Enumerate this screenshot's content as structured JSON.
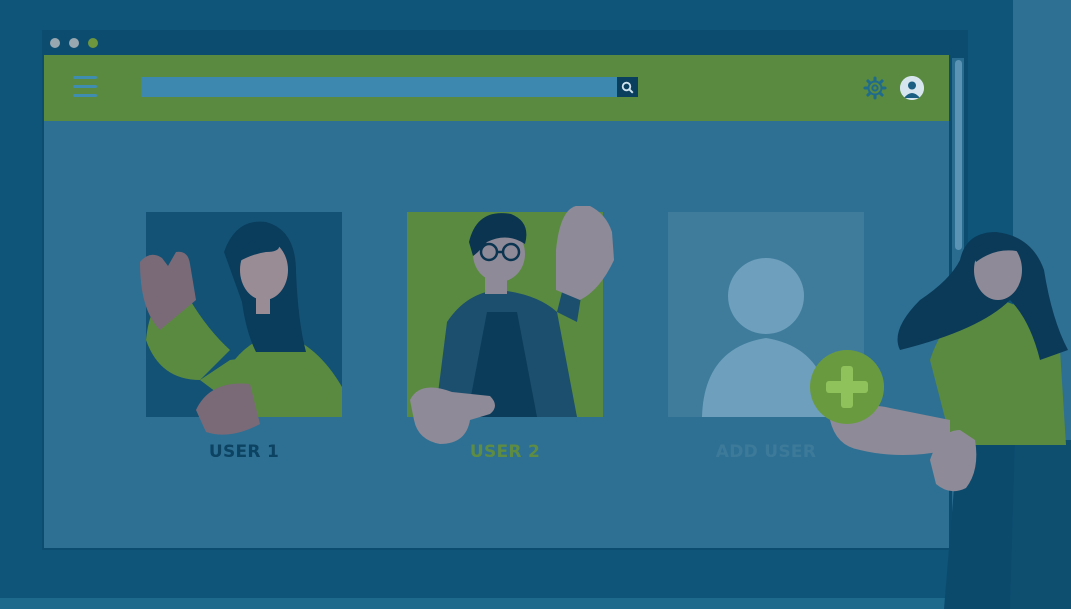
{
  "window": {
    "dots": [
      {
        "name": "close-dot",
        "color": "#98a7b0"
      },
      {
        "name": "minimize-dot",
        "color": "#98a7b0"
      },
      {
        "name": "maximize-dot",
        "color": "#6d963e"
      }
    ]
  },
  "toolbar": {
    "menu_icon": "hamburger-menu-icon",
    "search_placeholder": "",
    "search_icon": "search-icon",
    "settings_icon": "gear-icon",
    "account_icon": "user-avatar-icon"
  },
  "users": [
    {
      "label": "USER 1"
    },
    {
      "label": "USER 2"
    }
  ],
  "add_user": {
    "label": "ADD USER",
    "icon": "plus-icon"
  },
  "colors": {
    "background": "#0e5579",
    "toolbar": "#5a8a3f",
    "content": "#2e7093",
    "user1_label": "#0c4262",
    "user2_label": "#5e8c43",
    "add_user_label": "#3d7a99"
  }
}
